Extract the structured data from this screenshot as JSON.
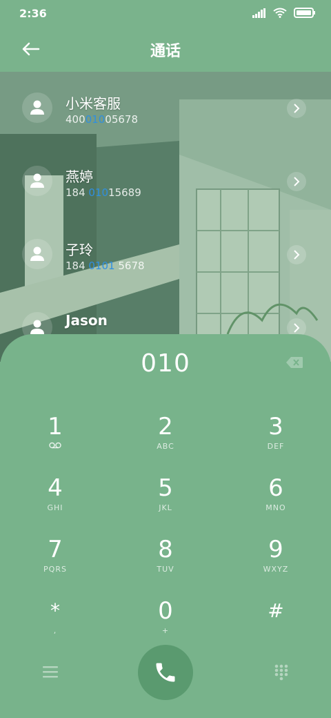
{
  "status": {
    "time": "2:36",
    "icons": [
      "signal-icon",
      "wifi-icon",
      "battery-icon"
    ]
  },
  "header": {
    "title": "通话",
    "back_icon": "back-arrow-icon"
  },
  "contacts": [
    {
      "name": "小米客服",
      "number_pre": "400",
      "number_hl": "010",
      "number_post": "05678"
    },
    {
      "name": "燕婷",
      "number_pre": "184 ",
      "number_hl": "010",
      "number_post": "15689"
    },
    {
      "name": "子玲",
      "number_pre": "184 ",
      "number_hl": "0101",
      "number_post": " 5678"
    },
    {
      "name": "Jason",
      "number_pre": "",
      "number_hl": "",
      "number_post": ""
    }
  ],
  "dialer": {
    "input": "010",
    "keys": [
      {
        "digit": "1",
        "letters": ""
      },
      {
        "digit": "2",
        "letters": "ABC"
      },
      {
        "digit": "3",
        "letters": "DEF"
      },
      {
        "digit": "4",
        "letters": "GHI"
      },
      {
        "digit": "5",
        "letters": "JKL"
      },
      {
        "digit": "6",
        "letters": "MNO"
      },
      {
        "digit": "7",
        "letters": "PQRS"
      },
      {
        "digit": "8",
        "letters": "TUV"
      },
      {
        "digit": "9",
        "letters": "WXYZ"
      },
      {
        "digit": "*",
        "letters": ","
      },
      {
        "digit": "0",
        "letters": "+"
      },
      {
        "digit": "#",
        "letters": ""
      }
    ]
  },
  "colors": {
    "background": "#7ab38c",
    "highlight": "#2f8fe0",
    "call_button": "#5a9a6f"
  }
}
